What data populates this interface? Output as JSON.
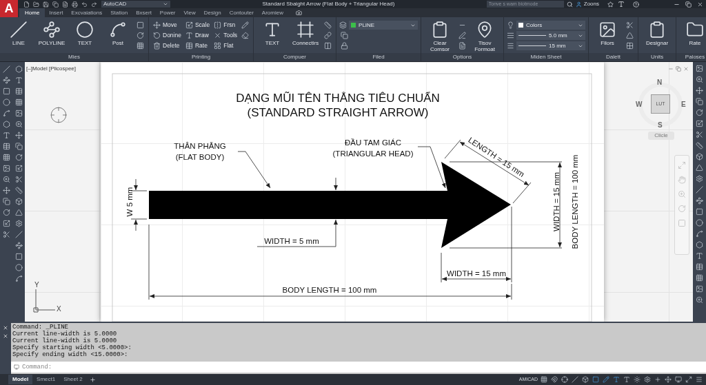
{
  "title_bar": {
    "logo": "A",
    "workspace": "AutoCAD",
    "title": "Standard Sbaight Arrow (Flat Body + Triangular Head)",
    "search": {
      "placeholder": "Tonve s wam biotmode"
    },
    "user": "Zoons"
  },
  "ribbon_tabs": [
    {
      "label": "Home",
      "selected": true
    },
    {
      "label": "Insert",
      "selected": false
    },
    {
      "label": "Excvaiations",
      "selected": false
    },
    {
      "label": "Station",
      "selected": false
    },
    {
      "label": "Bxsert",
      "selected": false
    },
    {
      "label": "Power",
      "selected": false
    },
    {
      "label": "View",
      "selected": false
    },
    {
      "label": "Design",
      "selected": false
    },
    {
      "label": "Contouter",
      "selected": false
    },
    {
      "label": "Aromiew",
      "selected": false
    }
  ],
  "ribbon_panels": [
    {
      "title": "Mies",
      "tools": [
        {
          "kind": "large",
          "label": "LINE"
        },
        {
          "kind": "large",
          "label": "POLYLINE"
        },
        {
          "kind": "large",
          "label": "TEXT"
        },
        {
          "kind": "large",
          "label": "Post"
        },
        {
          "kind": "small"
        },
        {
          "kind": "small"
        },
        {
          "kind": "small"
        }
      ]
    },
    {
      "title": "Printing",
      "tools": [
        {
          "kind": "small",
          "label": "Move"
        },
        {
          "kind": "small",
          "label": "Donine"
        },
        {
          "kind": "small",
          "label": "Delete"
        },
        {
          "kind": "small",
          "label": "Scale"
        },
        {
          "kind": "small",
          "label": "Draw"
        },
        {
          "kind": "small",
          "label": "Rate"
        },
        {
          "kind": "small",
          "label": "Frsn"
        },
        {
          "kind": "small",
          "label": "Tools"
        },
        {
          "kind": "small",
          "label": "Flat"
        },
        {
          "kind": "small"
        },
        {
          "kind": "small"
        }
      ]
    },
    {
      "title": "Compuer",
      "tools": [
        {
          "kind": "large",
          "label": "TEXT"
        },
        {
          "kind": "large",
          "label": "Connectirs"
        },
        {
          "kind": "small"
        },
        {
          "kind": "small"
        },
        {
          "kind": "small"
        }
      ]
    },
    {
      "title": "Filed",
      "tools": [
        {
          "kind": "dropdown",
          "value": "PLINE",
          "color": "#3cbf4a"
        },
        {
          "kind": "small"
        },
        {
          "kind": "small"
        }
      ]
    },
    {
      "title": "Options",
      "tools": [
        {
          "kind": "large",
          "label": "Clear Comsor"
        },
        {
          "kind": "small"
        },
        {
          "kind": "small"
        },
        {
          "kind": "small"
        },
        {
          "kind": "large",
          "label": "Tisov Formoat"
        }
      ]
    },
    {
      "title": "Miden Sheet",
      "tools": [
        {
          "kind": "dropdown",
          "value": "Colors"
        },
        {
          "kind": "dropdown",
          "value": "5.0 mm"
        },
        {
          "kind": "dropdown",
          "value": "15 mm"
        }
      ]
    },
    {
      "title": "Dalett",
      "tools": [
        {
          "kind": "large",
          "label": "Filors"
        },
        {
          "kind": "small"
        },
        {
          "kind": "small"
        },
        {
          "kind": "small"
        }
      ]
    },
    {
      "title": "Units",
      "tools": [
        {
          "kind": "large",
          "label": "Designar"
        }
      ]
    },
    {
      "title": "Paloses",
      "tools": [
        {
          "kind": "large",
          "label": "Rate"
        }
      ]
    }
  ],
  "viewport": {
    "label": "[–]Model [Plicospee]",
    "ucs": {
      "x": "X",
      "y": "Y"
    }
  },
  "drawing": {
    "title": [
      "DẠNG MŨI TÊN THẲNG TIÊU CHUẨN",
      "(STANDARD STRAIGHT ARROW)"
    ],
    "annotations": [
      {
        "lines": [
          "THÂN PHẲNG",
          "(FLAT BODY)"
        ]
      },
      {
        "lines": [
          "ĐẦU TAM GIÁC",
          "(TRIANGULAR HEAD)"
        ]
      },
      {
        "lines": [
          "LENGTH = 15 mm"
        ]
      },
      {
        "lines": [
          "WIDTH = 15 mm"
        ]
      },
      {
        "lines": [
          "BODY LENGTH = 100 mm"
        ]
      },
      {
        "lines": [
          "W 5 mm"
        ]
      },
      {
        "lines": [
          "WIDTH = 5 mm"
        ]
      },
      {
        "lines": [
          "WIDTH = 15 mm"
        ]
      },
      {
        "lines": [
          "BODY LENGTH = 100 mm"
        ]
      }
    ]
  },
  "viewcube": {
    "north": "N",
    "west": "W",
    "east": "E",
    "south": "S",
    "face": "LUT",
    "wcs": "Clicle"
  },
  "command_window": {
    "history": [
      "Command: _PLINE",
      "Current line-width is 5.0000",
      "Current line-width is 5.0000",
      "Specify starting width <5.0000>:",
      "Specify ending width <15.0000>:"
    ],
    "input": {
      "placeholder": "Command:"
    }
  },
  "status_bar": {
    "layouts": [
      {
        "label": "Model",
        "selected": true
      },
      {
        "label": "Smect1",
        "selected": false
      },
      {
        "label": "Sheet 2",
        "selected": false
      }
    ],
    "product": "AMICAD"
  }
}
